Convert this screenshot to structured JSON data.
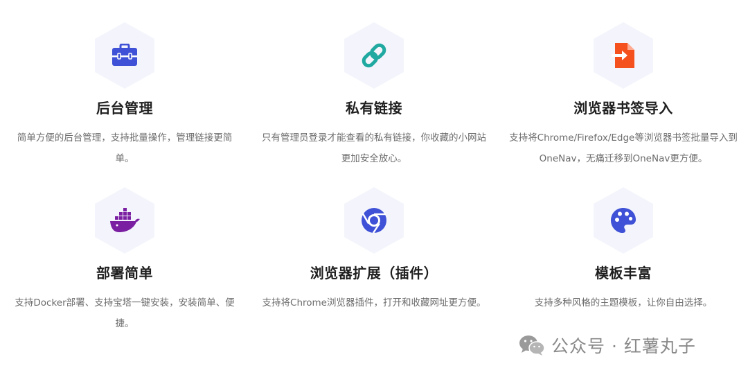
{
  "features": [
    {
      "icon": "toolbox-icon",
      "title": "后台管理",
      "desc": "简单方便的后台管理，支持批量操作，管理链接更简单。"
    },
    {
      "icon": "link-icon",
      "title": "私有链接",
      "desc": "只有管理员登录才能查看的私有链接，你收藏的小网站更加安全放心。"
    },
    {
      "icon": "file-import-icon",
      "title": "浏览器书签导入",
      "desc": "支持将Chrome/Firefox/Edge等浏览器书签批量导入到OneNav，无痛迁移到OneNav更方便。"
    },
    {
      "icon": "docker-icon",
      "title": "部署简单",
      "desc": "支持Docker部署、支持宝塔一键安装，安装简单、便捷。"
    },
    {
      "icon": "chrome-icon",
      "title": "浏览器扩展（插件）",
      "desc": "支持将Chrome浏览器插件，打开和收藏网址更方便。"
    },
    {
      "icon": "palette-icon",
      "title": "模板丰富",
      "desc": "支持多种风格的主题模板，让你自由选择。"
    }
  ],
  "watermark": {
    "text": "公众号 · 红薯丸子",
    "icon": "wechat-icon"
  },
  "colors": {
    "hex_bg": "#f4f5fc",
    "toolbox": "#3f51d6",
    "link": "#1fa9a0",
    "file_import": "#f4511e",
    "docker": "#7b1fa2",
    "chrome": "#3f51d6",
    "palette": "#3f51d6",
    "title": "#1f1f1f",
    "desc": "#6b6b6b",
    "watermark": "#8a8a8a"
  }
}
